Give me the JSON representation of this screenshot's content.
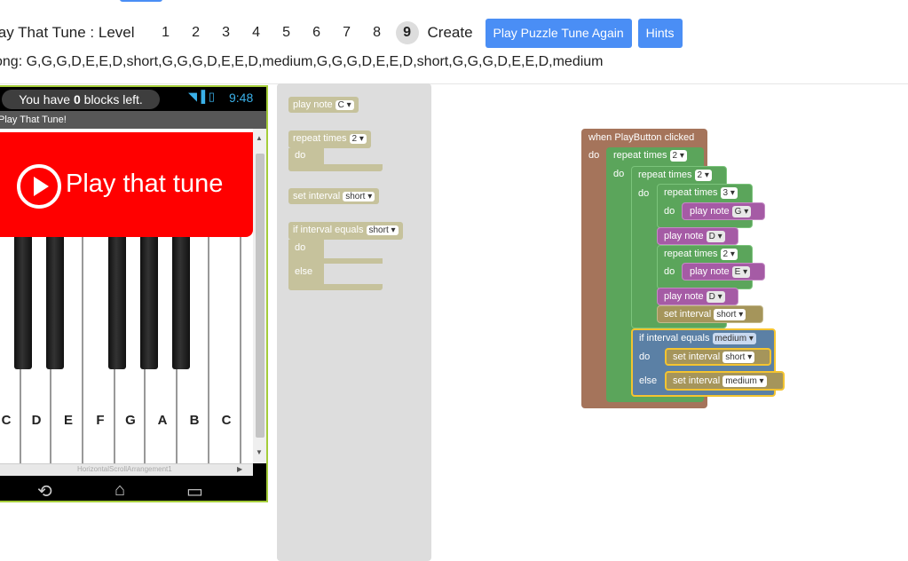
{
  "header": {
    "title": "lay That Tune : Level",
    "levels": [
      "1",
      "2",
      "3",
      "4",
      "5",
      "6",
      "7",
      "8",
      "9"
    ],
    "active_level": "9",
    "create_label": "Create",
    "play_again_label": "Play Puzzle Tune Again",
    "hints_label": "Hints",
    "song": "ong: G,G,G,D,E,E,D,short,G,G,G,D,E,E,D,medium,G,G,G,D,E,E,D,short,G,G,G,D,E,E,D,medium"
  },
  "phone": {
    "blocks_left_prefix": "You have ",
    "blocks_left_count": "0",
    "blocks_left_suffix": " blocks left.",
    "status_icons": "◥▐ ▯",
    "time": "9:48",
    "app_title": "Play That Tune!",
    "play_label": "Play that tune",
    "keys": [
      "C",
      "D",
      "E",
      "F",
      "G",
      "A",
      "B",
      "C"
    ],
    "scroll_label": "HorizontalScrollArrangement1",
    "accent_color": "#ff0000",
    "nav_icons": [
      "back-icon",
      "home-icon",
      "recent-apps-icon"
    ]
  },
  "toolbox": {
    "play_note": {
      "label": "play note",
      "value": "C ▾"
    },
    "repeat": {
      "label": "repeat times",
      "value": "2 ▾",
      "do": "do"
    },
    "set_interval": {
      "label": "set interval",
      "value": "short ▾"
    },
    "if_interval": {
      "label": "if interval equals",
      "value": "short ▾",
      "do": "do",
      "else": "else"
    }
  },
  "workspace": {
    "event": "when PlayButton clicked",
    "do": "do",
    "repeat_label": "repeat times",
    "repeat_outer": "2 ▾",
    "repeat_inner": "2 ▾",
    "repeat_three": "3 ▾",
    "repeat_two": "2 ▾",
    "play_note_label": "play note",
    "note_g": "G ▾",
    "note_d1": "D ▾",
    "note_e": "E ▾",
    "note_d2": "D ▾",
    "set_interval_label": "set interval",
    "interval_short_1": "short ▾",
    "if_label": "if interval equals",
    "if_value": "medium ▾",
    "else": "else",
    "interval_short_2": "short ▾",
    "interval_medium": "medium ▾"
  }
}
